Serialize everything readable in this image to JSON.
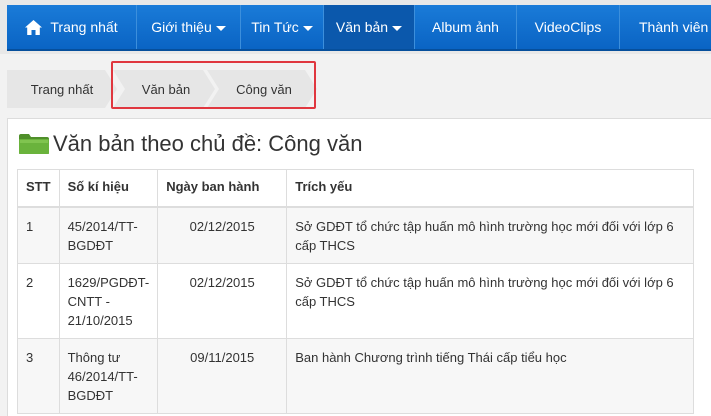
{
  "nav": {
    "items": [
      {
        "label": "Trang nhất",
        "icon": "home-icon"
      },
      {
        "label": "Giới thiệu",
        "dropdown": true
      },
      {
        "label": "Tin Tức",
        "dropdown": true
      },
      {
        "label": "Văn bản",
        "dropdown": true,
        "active": true
      },
      {
        "label": "Album ảnh"
      },
      {
        "label": "VideoClips"
      },
      {
        "label": "Thành viên"
      }
    ]
  },
  "breadcrumb": [
    "Trang nhất",
    "Văn bản",
    "Công văn"
  ],
  "page": {
    "title": "Văn bản theo chủ đề: Công văn",
    "icon": "folder-icon"
  },
  "table": {
    "headers": [
      "STT",
      "Số kí hiệu",
      "Ngày ban hành",
      "Trích yếu"
    ],
    "rows": [
      {
        "stt": "1",
        "so": "45/2014/TT-BGDĐT",
        "date": "02/12/2015",
        "summary": "Sở GDĐT tổ chức tập huấn mô hình trường học mới đối với lớp 6 cấp THCS"
      },
      {
        "stt": "2",
        "so": "1629/PGDĐT-CNTT - 21/10/2015",
        "date": "02/12/2015",
        "summary": "Sở GDĐT tổ chức tập huấn mô hình trường học mới đối với lớp 6 cấp THCS"
      },
      {
        "stt": "3",
        "so": "Thông tư 46/2014/TT-BGDĐT",
        "date": "09/11/2015",
        "summary": "Ban hành Chương trình tiếng Thái cấp tiểu học"
      }
    ]
  },
  "colors": {
    "nav_blue": "#0a64c4",
    "nav_active": "#0b58ac",
    "highlight_red": "#e0373f",
    "folder_green": "#6ab33c"
  }
}
